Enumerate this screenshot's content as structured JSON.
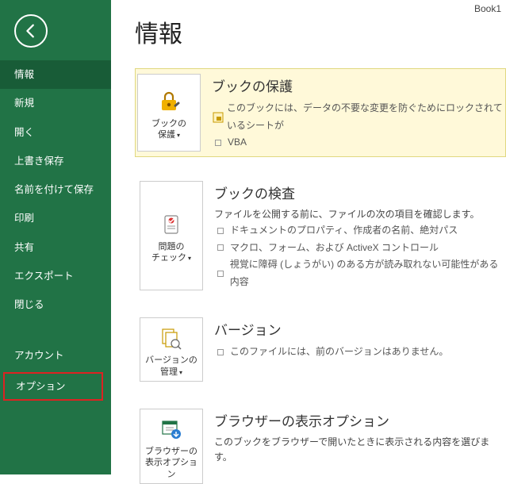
{
  "header": {
    "book_name": "Book1"
  },
  "page_title": "情報",
  "sidebar": {
    "items": [
      "情報",
      "新規",
      "開く",
      "上書き保存",
      "名前を付けて保存",
      "印刷",
      "共有",
      "エクスポート",
      "閉じる"
    ],
    "bottom_items": [
      "アカウント",
      "オプション"
    ],
    "selected_index": 0,
    "highlighted_bottom_index": 1
  },
  "sections": {
    "protect": {
      "tile_label1": "ブックの",
      "tile_label2": "保護",
      "heading": "ブックの保護",
      "sub1_text": "このブックには、データの不要な変更を防ぐためにロックされているシートが",
      "sub2_text": "VBA"
    },
    "inspect": {
      "tile_label1": "問題の",
      "tile_label2": "チェック",
      "heading": "ブックの検査",
      "intro": "ファイルを公開する前に、ファイルの次の項目を確認します。",
      "b1": "ドキュメントのプロパティ、作成者の名前、絶対パス",
      "b2": "マクロ、フォーム、および ActiveX コントロール",
      "b3": "視覚に障碍 (しょうがい) のある方が読み取れない可能性がある内容"
    },
    "versions": {
      "tile_label1": "バージョンの",
      "tile_label2": "管理",
      "heading": "バージョン",
      "b1": "このファイルには、前のバージョンはありません。"
    },
    "browser": {
      "tile_label1": "ブラウザーの",
      "tile_label2": "表示オプション",
      "heading": "ブラウザーの表示オプション",
      "text": "このブックをブラウザーで開いたときに表示される内容を選びます。"
    }
  }
}
